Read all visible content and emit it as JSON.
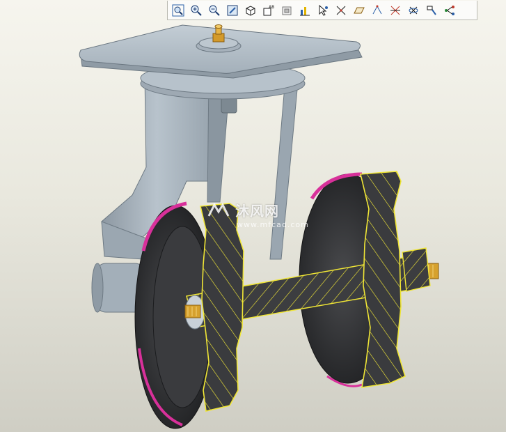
{
  "toolbar": {
    "buttons": [
      {
        "icon": "zoom-window-icon"
      },
      {
        "icon": "zoom-in-icon"
      },
      {
        "icon": "zoom-out-icon"
      },
      {
        "icon": "refit-icon"
      },
      {
        "icon": "orient-view-icon"
      },
      {
        "icon": "named-views-icon"
      },
      {
        "icon": "repaint-icon"
      },
      {
        "icon": "datum-display-icon"
      },
      {
        "icon": "select-point-icon"
      },
      {
        "icon": "axis-display-icon"
      },
      {
        "icon": "plane-display-icon"
      },
      {
        "icon": "point-display-icon"
      },
      {
        "icon": "csys-display-icon"
      },
      {
        "icon": "spin-center-icon"
      },
      {
        "icon": "annotation-display-icon"
      },
      {
        "icon": "model-tree-icon"
      }
    ]
  },
  "watermark": {
    "brand": "沐风网",
    "site": "www.mfcad.com"
  },
  "colors": {
    "section_hatch": "#f0e636",
    "tread": "#d8309a",
    "wheel": "#2d2e30",
    "frame": "#a7b3bd",
    "plate": "#b5c1ca"
  }
}
